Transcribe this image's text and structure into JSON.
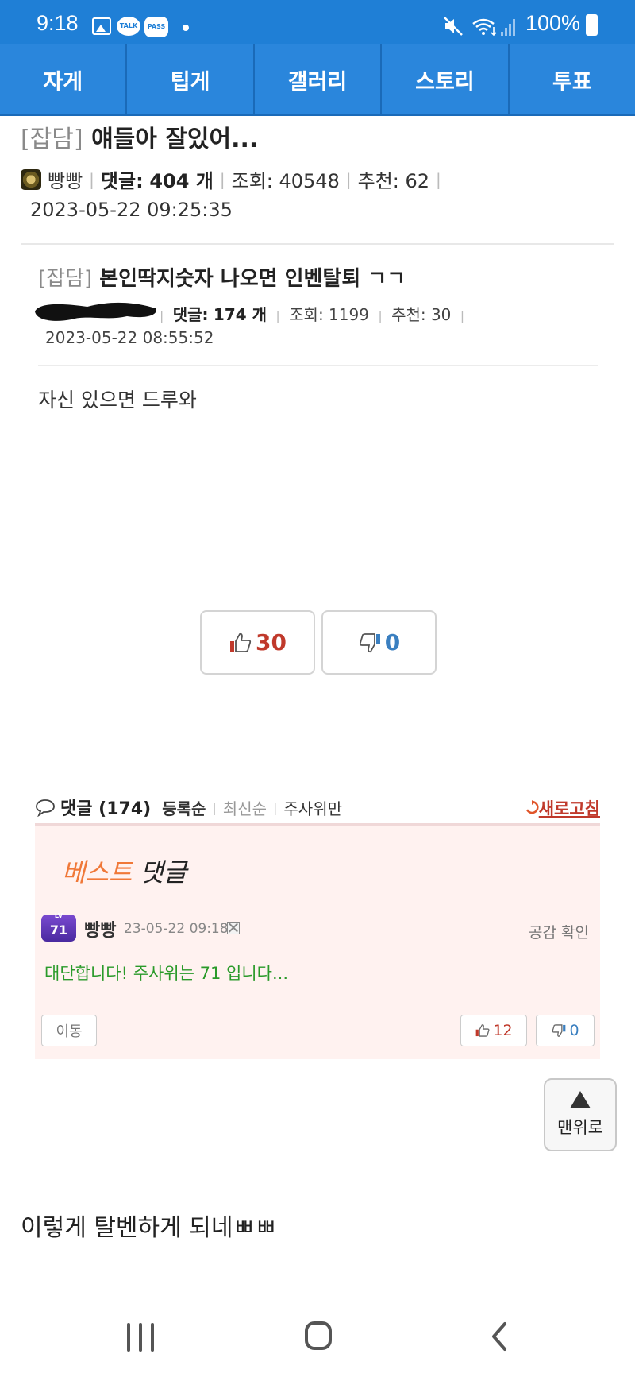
{
  "status_bar": {
    "time": "9:18",
    "talk_label": "TALK",
    "pass_label": "PASS",
    "battery": "100%"
  },
  "nav": {
    "tabs": [
      "자게",
      "팁게",
      "갤러리",
      "스토리",
      "투표"
    ]
  },
  "post": {
    "category": "[잡담]",
    "title": "얘들아 잘있어...",
    "author": "빵빵",
    "comments_label": "댓글:",
    "comments_value": "404 개",
    "views": "조회: 40548",
    "recommend": "추천: 62",
    "date": "2023-05-22 09:25:35"
  },
  "quoted_post": {
    "category": "[잡담]",
    "title": "본인딱지숫자 나오면 인벤탈퇴 ㄱㄱ",
    "comments_label": "댓글:",
    "comments_value": "174 개",
    "views": "조회: 1199",
    "recommend": "추천: 30",
    "date": "2023-05-22 08:55:52",
    "body": "자신 있으면 드루와"
  },
  "votes": {
    "up": "30",
    "down": "0"
  },
  "comments": {
    "title": "댓글",
    "count": "(174)",
    "sort_options": [
      "등록순",
      "최신순",
      "주사위만"
    ],
    "refresh": "새로고침",
    "best_label_1": "베스트",
    "best_label_2": "댓글",
    "best": {
      "level": "71",
      "user": "빵빵",
      "time": "23-05-22 09:18",
      "empathy": "공감 확인",
      "text": "대단합니다! 주사위는 71 입니다...",
      "move": "이동",
      "up": "12",
      "down": "0"
    }
  },
  "to_top": "맨위로",
  "caption": "이렇게 탈벤하게 되네ㅃㅃ",
  "colors": {
    "primary_blue": "#2a86dc",
    "vote_red": "#c0392b",
    "vote_blue": "#3a7fc0",
    "best_bg": "#fff2f0",
    "comment_green": "#2a9a2a"
  }
}
